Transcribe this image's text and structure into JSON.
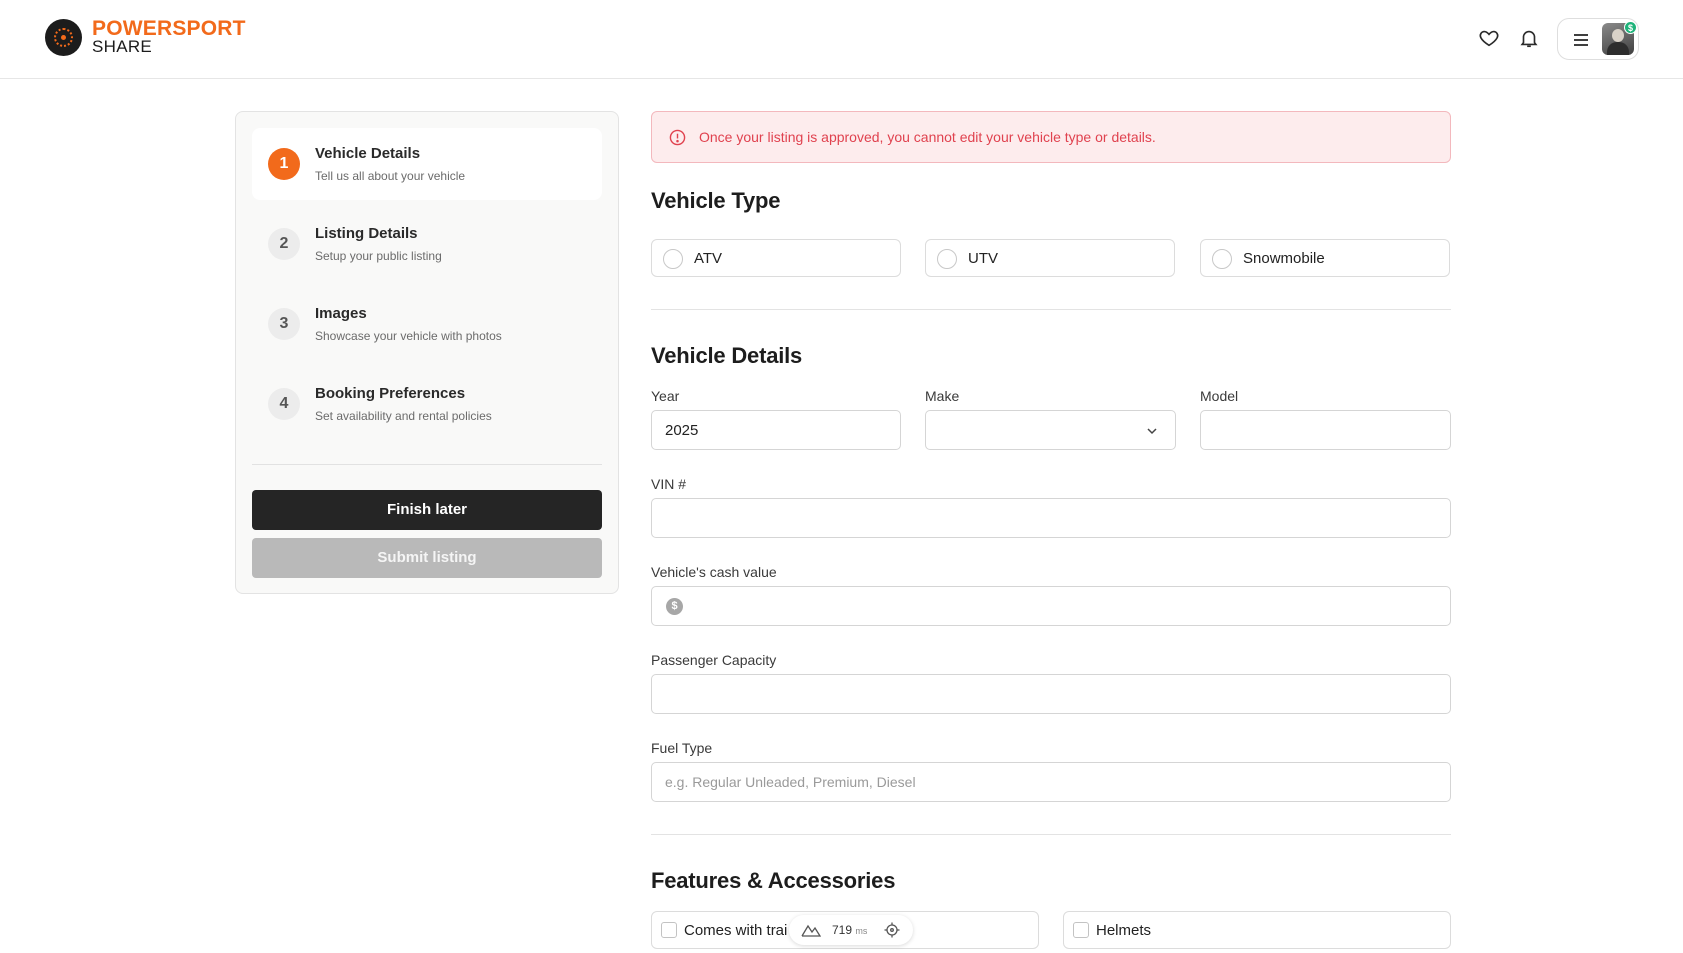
{
  "brand": {
    "line1": "POWERSPORT",
    "line2": "SHARE",
    "accent": "#f26a1b"
  },
  "header": {
    "icons": [
      "heart-icon",
      "bell-icon",
      "menu-icon"
    ],
    "avatar_badge": "$"
  },
  "steps": [
    {
      "num": "1",
      "title": "Vehicle Details",
      "subtitle": "Tell us all about your vehicle",
      "active": true
    },
    {
      "num": "2",
      "title": "Listing Details",
      "subtitle": "Setup your public listing",
      "active": false
    },
    {
      "num": "3",
      "title": "Images",
      "subtitle": "Showcase your vehicle with photos",
      "active": false
    },
    {
      "num": "4",
      "title": "Booking Preferences",
      "subtitle": "Set availability and rental policies",
      "active": false
    }
  ],
  "sidebar": {
    "finish_label": "Finish later",
    "submit_label": "Submit listing"
  },
  "alert": {
    "message": "Once your listing is approved, you cannot edit your vehicle type or details.",
    "color": "#e0424f"
  },
  "vehicle_type": {
    "heading": "Vehicle Type",
    "options": [
      "ATV",
      "UTV",
      "Snowmobile"
    ]
  },
  "vehicle_details": {
    "heading": "Vehicle Details",
    "year_label": "Year",
    "year_value": "2025",
    "make_label": "Make",
    "make_value": "",
    "model_label": "Model",
    "model_value": "",
    "vin_label": "VIN #",
    "cash_label": "Vehicle's cash value",
    "cash_icon": "$",
    "passenger_label": "Passenger Capacity",
    "fuel_label": "Fuel Type",
    "fuel_placeholder": "e.g. Regular Unleaded, Premium, Diesel"
  },
  "features": {
    "heading": "Features & Accessories",
    "items": [
      "Comes with trai",
      "Helmets"
    ]
  },
  "dev_overlay": {
    "value": "719",
    "unit": "ms"
  }
}
